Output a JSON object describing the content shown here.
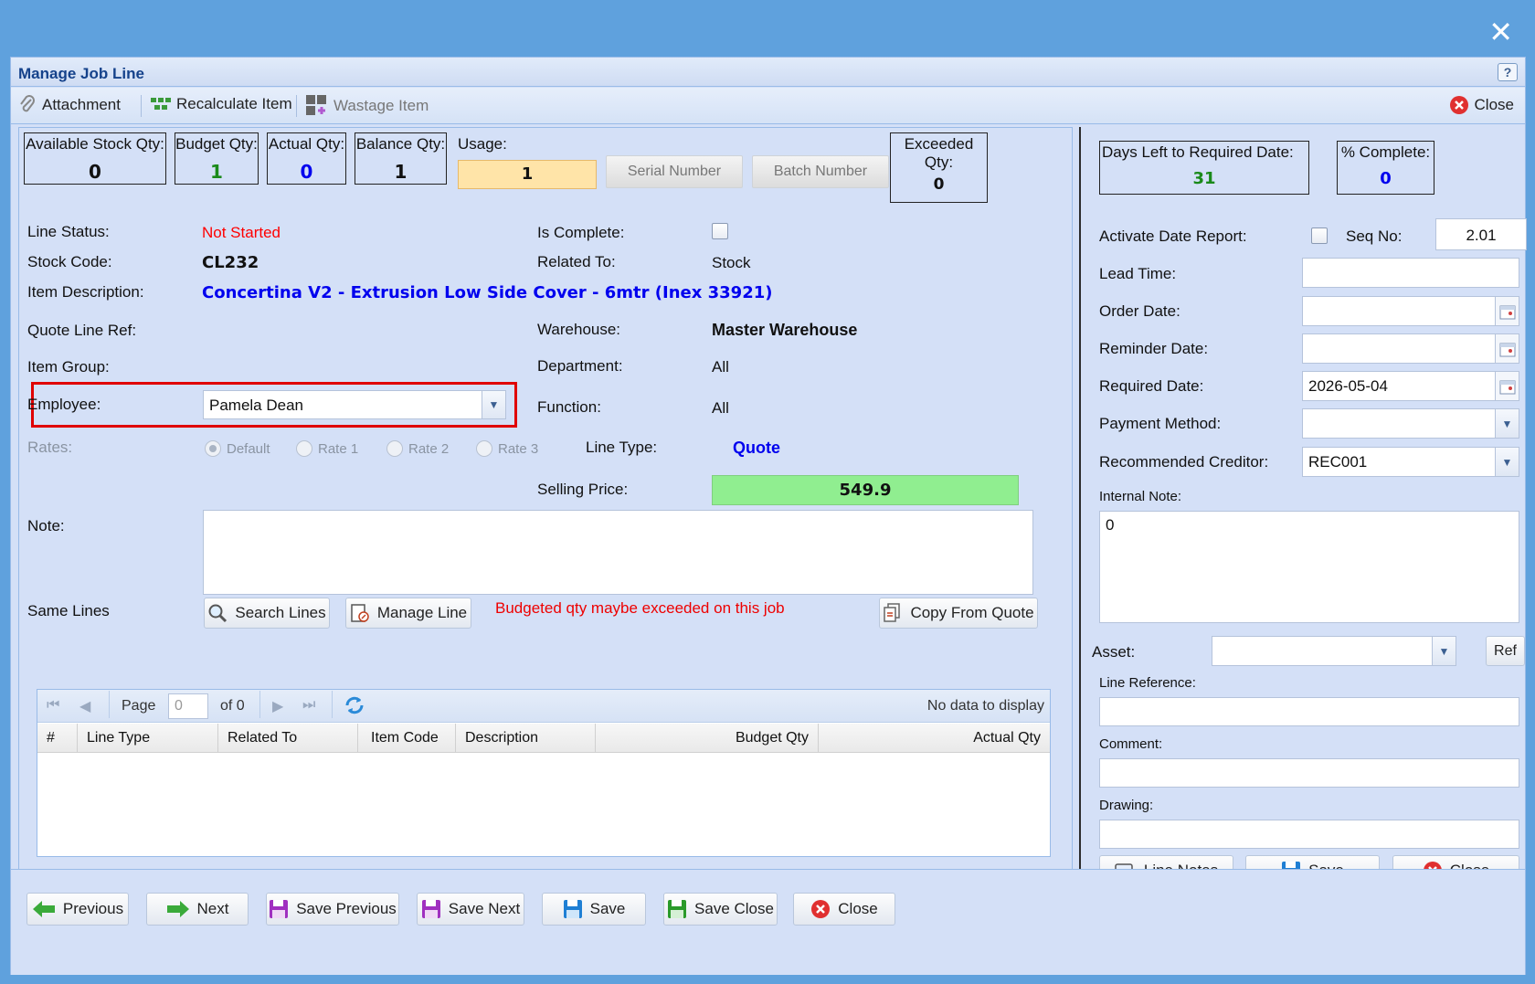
{
  "window": {
    "title": "Manage Job Line",
    "help": "?"
  },
  "toolbar": {
    "attachment": "Attachment",
    "recalculate": "Recalculate Item",
    "wastage": "Wastage Item",
    "close": "Close"
  },
  "quantities": {
    "available_stock": {
      "label": "Available Stock Qty:",
      "value": "0"
    },
    "budget": {
      "label": "Budget Qty:",
      "value": "1"
    },
    "actual": {
      "label": "Actual Qty:",
      "value": "0"
    },
    "balance": {
      "label": "Balance Qty:",
      "value": "1"
    },
    "usage": {
      "label": "Usage:",
      "value": "1"
    },
    "serial_number": "Serial Number",
    "batch_number": "Batch Number",
    "exceeded": {
      "label": "Exceeded Qty:",
      "value": "0"
    }
  },
  "details": {
    "line_status_label": "Line Status:",
    "line_status": "Not Started",
    "stock_code_label": "Stock Code:",
    "stock_code": "CL232",
    "item_description_label": "Item Description:",
    "item_description": "Concertina V2 - Extrusion Low Side Cover - 6mtr (Inex 33921)",
    "quote_line_ref_label": "Quote Line Ref:",
    "item_group_label": "Item Group:",
    "employee_label": "Employee:",
    "employee": "Pamela Dean",
    "rates_label": "Rates:",
    "rates": [
      "Default",
      "Rate 1",
      "Rate 2",
      "Rate 3"
    ],
    "is_complete_label": "Is Complete:",
    "related_to_label": "Related To:",
    "related_to": "Stock",
    "warehouse_label": "Warehouse:",
    "warehouse": "Master Warehouse",
    "department_label": "Department:",
    "department": "All",
    "function_label": "Function:",
    "function": "All",
    "line_type_label": "Line Type:",
    "line_type": "Quote",
    "selling_price_label": "Selling Price:",
    "selling_price": "549.9",
    "note_label": "Note:"
  },
  "same_lines": {
    "label": "Same Lines",
    "search": "Search Lines",
    "manage": "Manage Line",
    "warning": "Budgeted qty maybe exceeded on this job",
    "copy": "Copy From Quote"
  },
  "grid": {
    "page_label": "Page",
    "page_value": "0",
    "of_label": "of 0",
    "empty": "No data to display",
    "columns": [
      "#",
      "Line Type",
      "Related To",
      "Item Code",
      "Description",
      "Budget Qty",
      "Actual Qty"
    ]
  },
  "right": {
    "days_left": {
      "label": "Days Left to Required Date:",
      "value": "31"
    },
    "percent_complete": {
      "label": "% Complete:",
      "value": "0"
    },
    "activate_date_report": "Activate Date Report:",
    "seq_no_label": "Seq No:",
    "seq_no": "2.01",
    "lead_time": "Lead Time:",
    "order_date": "Order Date:",
    "reminder_date": "Reminder Date:",
    "required_date_label": "Required Date:",
    "required_date": "2026-05-04",
    "payment_method": "Payment Method:",
    "recommended_creditor_label": "Recommended Creditor:",
    "recommended_creditor": "REC001",
    "internal_note_label": "Internal Note:",
    "internal_note": "0",
    "asset_label": "Asset:",
    "ref": "Ref",
    "line_reference": "Line Reference:",
    "comment": "Comment:",
    "drawing": "Drawing:",
    "line_notes": "Line Notes",
    "save": "Save",
    "close": "Close"
  },
  "footer": {
    "previous": "Previous",
    "next": "Next",
    "save_previous": "Save Previous",
    "save_next": "Save Next",
    "save": "Save",
    "save_close": "Save Close",
    "close": "Close"
  },
  "colors": {
    "red_status": "#ff0000",
    "green_value": "#1a8a1a",
    "blue_value": "#0000ee",
    "usage_bg": "#ffe4a8",
    "selling_bg": "#90ee90",
    "highlight_border": "#e00000"
  }
}
